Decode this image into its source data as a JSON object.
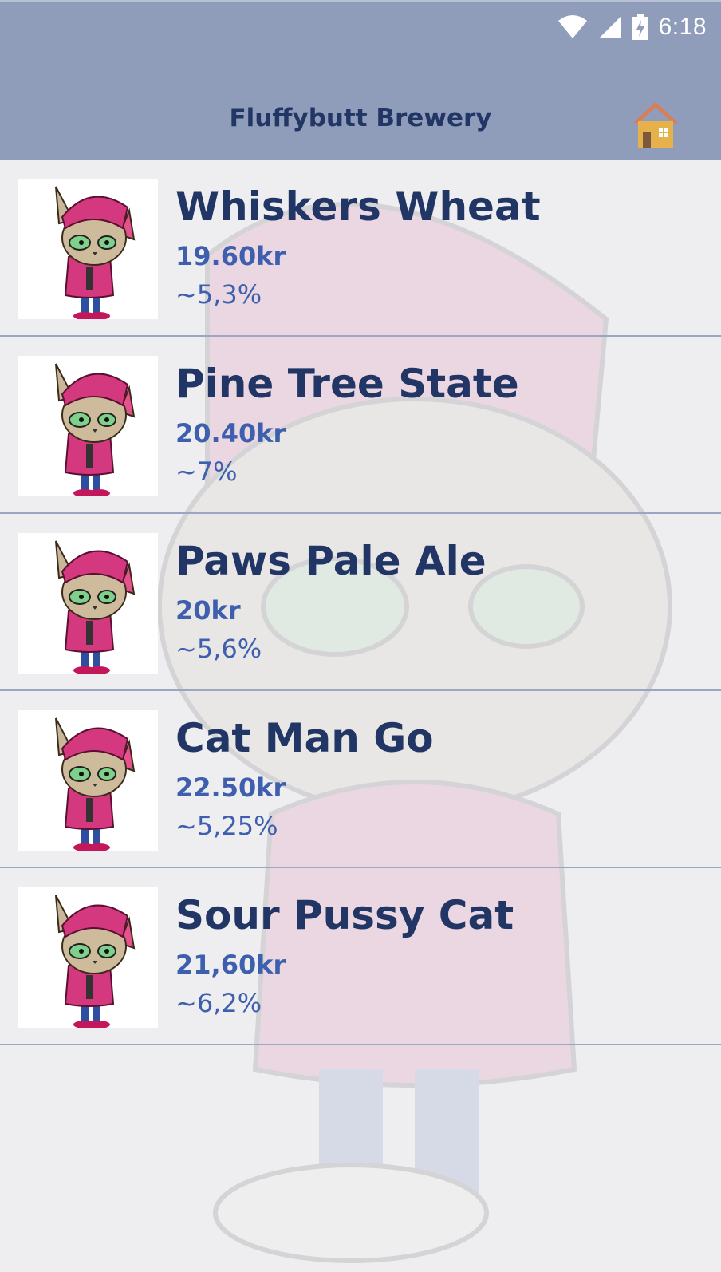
{
  "status_bar": {
    "time": "6:18",
    "icons": [
      "wifi-icon",
      "cell-signal-icon",
      "battery-charging-icon"
    ]
  },
  "app_bar": {
    "title": "Fluffybutt Brewery",
    "home_icon": "home-icon"
  },
  "colors": {
    "app_bar_bg": "#8f9dba",
    "title_text": "#223665",
    "accent_text": "#3e5fae",
    "divider": "#9aa6c2",
    "background": "#eeeef0"
  },
  "beers": [
    {
      "name": "Whiskers Wheat",
      "price": "19.60kr",
      "abv": "~5,3%"
    },
    {
      "name": "Pine Tree State",
      "price": "20.40kr",
      "abv": "~7%"
    },
    {
      "name": "Paws Pale Ale",
      "price": "20kr",
      "abv": "~5,6%"
    },
    {
      "name": "Cat Man Go",
      "price": "22.50kr",
      "abv": "~5,25%"
    },
    {
      "name": "Sour Pussy Cat",
      "price": "21,60kr",
      "abv": "~6,2%"
    }
  ]
}
